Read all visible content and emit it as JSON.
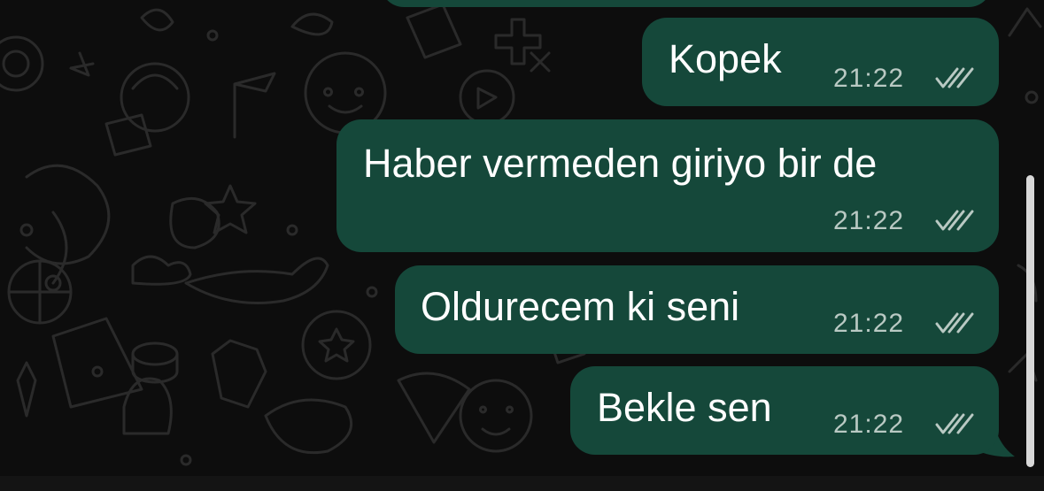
{
  "conversation": {
    "messages": [
      {
        "text": "Kopek",
        "time": "21:22",
        "status": "read",
        "status_icon": "double-check-icon"
      },
      {
        "text": "Haber vermeden giriyo bir de",
        "time": "21:22",
        "status": "read",
        "status_icon": "double-check-icon"
      },
      {
        "text": "Oldurecem ki seni",
        "time": "21:22",
        "status": "read",
        "status_icon": "double-check-icon"
      },
      {
        "text": "Bekle sen",
        "time": "21:22",
        "status": "read",
        "status_icon": "double-check-icon"
      }
    ]
  },
  "colors": {
    "background": "#0d0d0d",
    "bubble_outgoing": "#15483a",
    "message_text": "#ffffff",
    "meta_text": "#b9c9c3",
    "doodle_stroke": "#2a2a2a"
  }
}
